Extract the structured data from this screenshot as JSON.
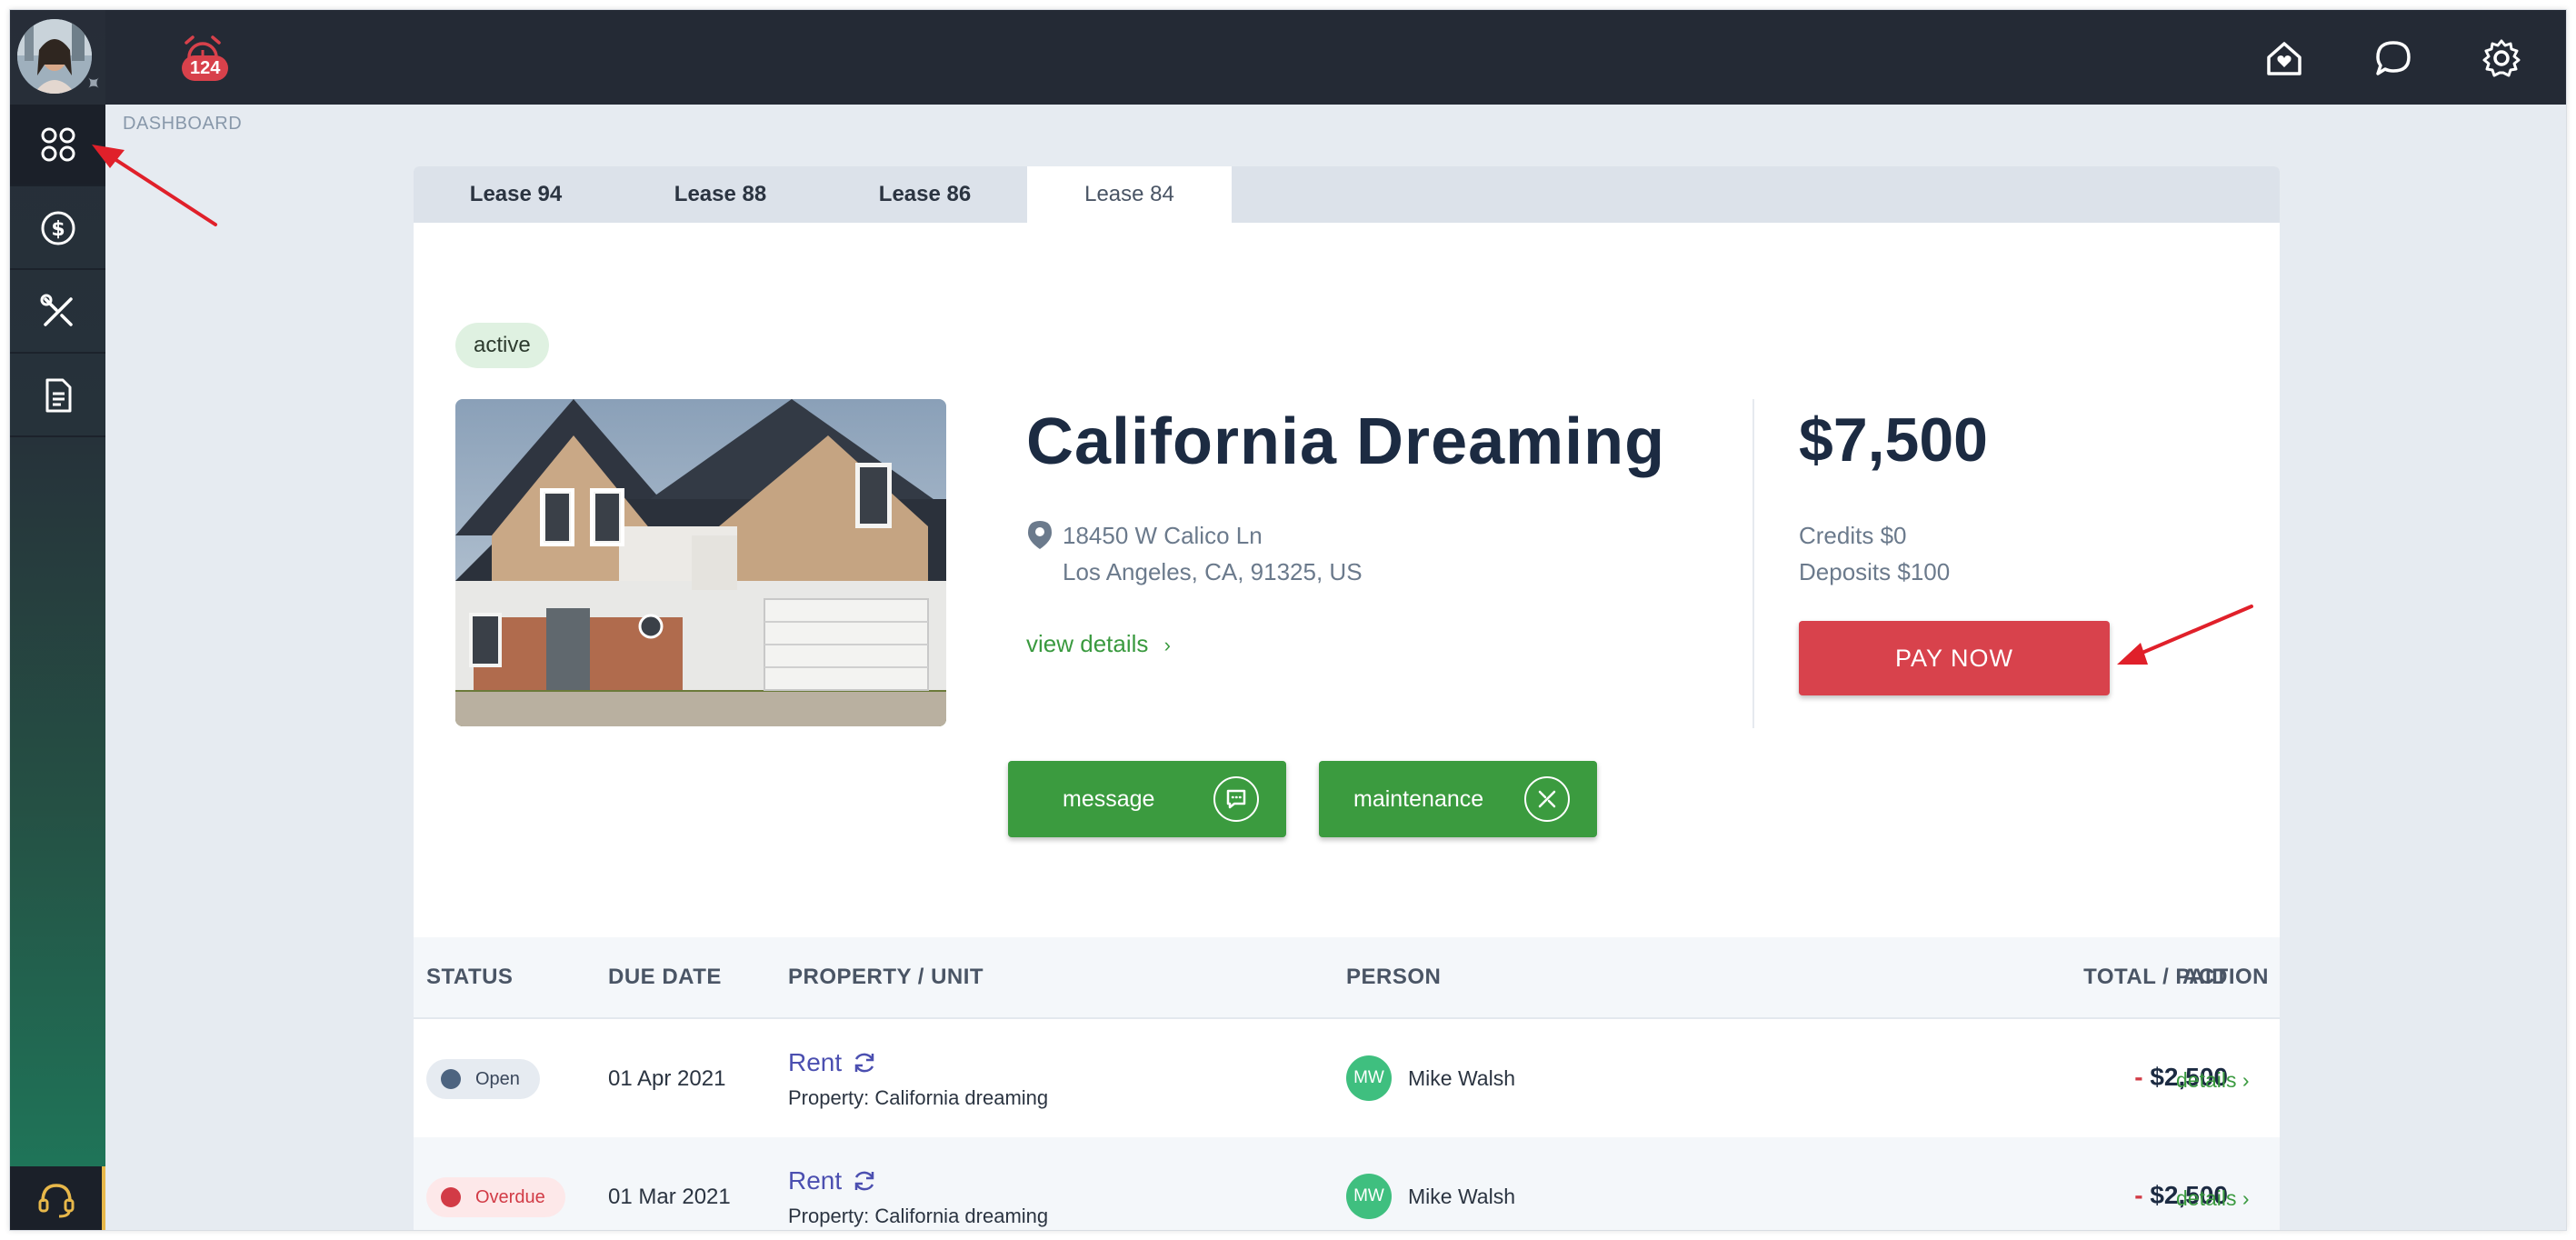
{
  "topbar": {
    "alarm_badge": "124"
  },
  "breadcrumb": "DASHBOARD",
  "tabs": [
    {
      "label": "Lease 94"
    },
    {
      "label": "Lease 88"
    },
    {
      "label": "Lease 86"
    },
    {
      "label": "Lease 84",
      "active": true
    }
  ],
  "lease": {
    "status": "active",
    "title": "California Dreaming",
    "address_line1": "18450 W Calico Ln",
    "address_line2": "Los Angeles, CA, 91325, US",
    "view_details": "view details",
    "amount": "$7,500",
    "credits": "Credits $0",
    "deposits": "Deposits $100",
    "pay_now": "PAY NOW",
    "message_btn": "message",
    "maintenance_btn": "maintenance"
  },
  "table": {
    "headers": {
      "status": "STATUS",
      "due_date": "DUE DATE",
      "property": "PROPERTY / UNIT",
      "person": "PERSON",
      "total": "TOTAL / PAID",
      "action": "ACTION"
    },
    "rows": [
      {
        "status": "Open",
        "due_date": "01 Apr 2021",
        "type": "Rent",
        "property": "Property: California dreaming",
        "initials": "MW",
        "person": "Mike Walsh",
        "minus": "-",
        "total": "$2,500",
        "action": "details"
      },
      {
        "status": "Overdue",
        "due_date": "01 Mar 2021",
        "type": "Rent",
        "property": "Property: California dreaming",
        "initials": "MW",
        "person": "Mike Walsh",
        "minus": "-",
        "total": "$2,500",
        "action": "details"
      }
    ]
  },
  "colors": {
    "accent_green": "#3b9b3f",
    "pay_red": "#d8424c",
    "topbar": "#242a35"
  }
}
